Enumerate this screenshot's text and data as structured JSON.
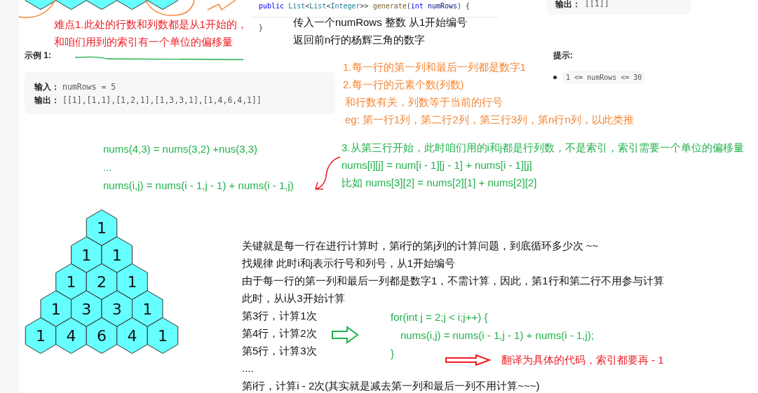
{
  "top_example_output": {
    "label": "输出：",
    "value": "[[1]]"
  },
  "signature": {
    "lines": [
      [
        {
          "kind": "keyword",
          "text": "public "
        },
        {
          "kind": "type",
          "text": "List"
        },
        {
          "kind": "plain",
          "text": "<"
        },
        {
          "kind": "type",
          "text": "List"
        },
        {
          "kind": "plain",
          "text": "<"
        },
        {
          "kind": "type",
          "text": "Integer"
        },
        {
          "kind": "plain",
          "text": ">> "
        },
        {
          "kind": "function",
          "text": "generate"
        },
        {
          "kind": "plain",
          "text": "("
        },
        {
          "kind": "keyword",
          "text": "int "
        },
        {
          "kind": "param",
          "text": "numRows"
        },
        {
          "kind": "plain",
          "text": ") {"
        }
      ],
      [
        {
          "kind": "plain",
          "text": "}"
        }
      ]
    ]
  },
  "difficulty_note": [
    "难点1.此处的行数和列数都是从1开始的，",
    "和咱们用到的索引有一个单位的偏移量"
  ],
  "description_note": [
    "传入一个numRows 整数 从1开始编号",
    "返回前n行的杨辉三角的数字"
  ],
  "example": {
    "title": "示例 1:",
    "input_label": "输入：",
    "input": "numRows = 5",
    "output_label": "输出：",
    "output": "[[1],[1,1],[1,2,1],[1,3,3,1],[1,4,6,4,1]]"
  },
  "hints": {
    "title": "提示:",
    "items": [
      "1 <= numRows <= 30"
    ]
  },
  "rule_notes": [
    "1.每一行的第一列和最后一列都是数字1",
    "2.每一行的元素个数(列数)",
    "和行数有关，列数等于当前的行号",
    "eg: 第一行1列，第二行2列，第三行3列，第n行n列，以此类推"
  ],
  "formulas": [
    "nums(4,3) = nums(3,2) +nus(3,3)",
    "...",
    "nums(i,j) = nums(i - 1,j - 1) + nums(i - 1,j)"
  ],
  "index_notes": [
    "3.从第三行开始，此时咱们用的i和j都是行列数，不是索引，索引需要一个单位的偏移量",
    "nums[i][j] = num[i - 1][j - 1] + nums[i - 1][j]",
    "比如 nums[3][2] = nums[2][1] + nums[2][2]"
  ],
  "pyramid": [
    [
      "1"
    ],
    [
      "1",
      "1"
    ],
    [
      "1",
      "2",
      "1"
    ],
    [
      "1",
      "3",
      "3",
      "1"
    ],
    [
      "1",
      "4",
      "6",
      "4",
      "1"
    ]
  ],
  "explanation": [
    "关键就是每一行在进行计算时，第i行的第j列的计算问题，到底循环多少次 ~~",
    "找规律 此时i和j表示行号和列号，从1开始编号",
    "由于每一行的第一列和最后一列都是数字1，不需计算，因此，第1行和第二行不用参与计算",
    "此时，从i从3开始计算",
    "第3行，计算1次",
    "第4行，计算2次",
    "第5行，计算3次",
    "....",
    "第i行，计算i - 2次(其实就是减去第一列和最后一列不用计算~~~)"
  ],
  "loop_code": [
    "for(int j = 2;j < i;j++) {",
    "nums(i,j) = nums(i - 1,j - 1) + nums(i - 1,j);",
    "}"
  ],
  "translate_note": "翻译为具体的代码，索引都要再 - 1"
}
